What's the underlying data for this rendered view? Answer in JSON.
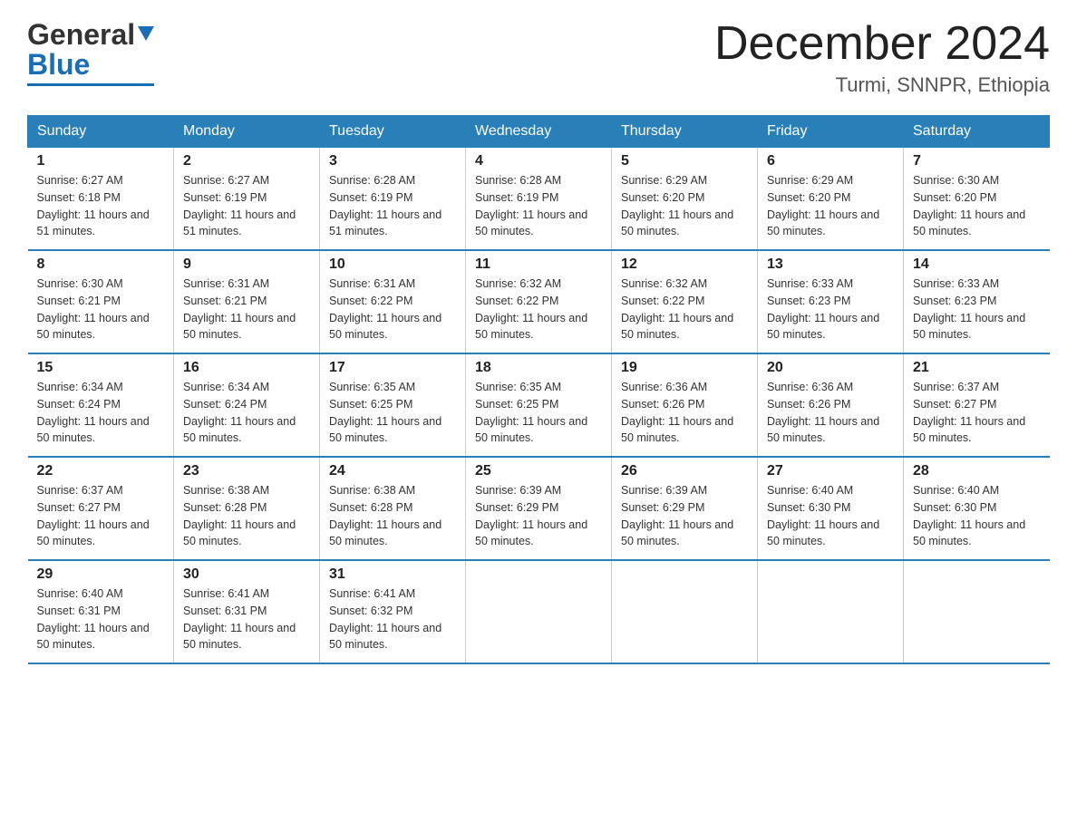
{
  "logo": {
    "general": "General",
    "blue": "Blue",
    "tagline": "GeneralBlue"
  },
  "header": {
    "month_year": "December 2024",
    "location": "Turmi, SNNPR, Ethiopia"
  },
  "days_of_week": [
    "Sunday",
    "Monday",
    "Tuesday",
    "Wednesday",
    "Thursday",
    "Friday",
    "Saturday"
  ],
  "weeks": [
    [
      {
        "day": 1,
        "sunrise": "6:27 AM",
        "sunset": "6:18 PM",
        "daylight": "11 hours and 51 minutes."
      },
      {
        "day": 2,
        "sunrise": "6:27 AM",
        "sunset": "6:19 PM",
        "daylight": "11 hours and 51 minutes."
      },
      {
        "day": 3,
        "sunrise": "6:28 AM",
        "sunset": "6:19 PM",
        "daylight": "11 hours and 51 minutes."
      },
      {
        "day": 4,
        "sunrise": "6:28 AM",
        "sunset": "6:19 PM",
        "daylight": "11 hours and 50 minutes."
      },
      {
        "day": 5,
        "sunrise": "6:29 AM",
        "sunset": "6:20 PM",
        "daylight": "11 hours and 50 minutes."
      },
      {
        "day": 6,
        "sunrise": "6:29 AM",
        "sunset": "6:20 PM",
        "daylight": "11 hours and 50 minutes."
      },
      {
        "day": 7,
        "sunrise": "6:30 AM",
        "sunset": "6:20 PM",
        "daylight": "11 hours and 50 minutes."
      }
    ],
    [
      {
        "day": 8,
        "sunrise": "6:30 AM",
        "sunset": "6:21 PM",
        "daylight": "11 hours and 50 minutes."
      },
      {
        "day": 9,
        "sunrise": "6:31 AM",
        "sunset": "6:21 PM",
        "daylight": "11 hours and 50 minutes."
      },
      {
        "day": 10,
        "sunrise": "6:31 AM",
        "sunset": "6:22 PM",
        "daylight": "11 hours and 50 minutes."
      },
      {
        "day": 11,
        "sunrise": "6:32 AM",
        "sunset": "6:22 PM",
        "daylight": "11 hours and 50 minutes."
      },
      {
        "day": 12,
        "sunrise": "6:32 AM",
        "sunset": "6:22 PM",
        "daylight": "11 hours and 50 minutes."
      },
      {
        "day": 13,
        "sunrise": "6:33 AM",
        "sunset": "6:23 PM",
        "daylight": "11 hours and 50 minutes."
      },
      {
        "day": 14,
        "sunrise": "6:33 AM",
        "sunset": "6:23 PM",
        "daylight": "11 hours and 50 minutes."
      }
    ],
    [
      {
        "day": 15,
        "sunrise": "6:34 AM",
        "sunset": "6:24 PM",
        "daylight": "11 hours and 50 minutes."
      },
      {
        "day": 16,
        "sunrise": "6:34 AM",
        "sunset": "6:24 PM",
        "daylight": "11 hours and 50 minutes."
      },
      {
        "day": 17,
        "sunrise": "6:35 AM",
        "sunset": "6:25 PM",
        "daylight": "11 hours and 50 minutes."
      },
      {
        "day": 18,
        "sunrise": "6:35 AM",
        "sunset": "6:25 PM",
        "daylight": "11 hours and 50 minutes."
      },
      {
        "day": 19,
        "sunrise": "6:36 AM",
        "sunset": "6:26 PM",
        "daylight": "11 hours and 50 minutes."
      },
      {
        "day": 20,
        "sunrise": "6:36 AM",
        "sunset": "6:26 PM",
        "daylight": "11 hours and 50 minutes."
      },
      {
        "day": 21,
        "sunrise": "6:37 AM",
        "sunset": "6:27 PM",
        "daylight": "11 hours and 50 minutes."
      }
    ],
    [
      {
        "day": 22,
        "sunrise": "6:37 AM",
        "sunset": "6:27 PM",
        "daylight": "11 hours and 50 minutes."
      },
      {
        "day": 23,
        "sunrise": "6:38 AM",
        "sunset": "6:28 PM",
        "daylight": "11 hours and 50 minutes."
      },
      {
        "day": 24,
        "sunrise": "6:38 AM",
        "sunset": "6:28 PM",
        "daylight": "11 hours and 50 minutes."
      },
      {
        "day": 25,
        "sunrise": "6:39 AM",
        "sunset": "6:29 PM",
        "daylight": "11 hours and 50 minutes."
      },
      {
        "day": 26,
        "sunrise": "6:39 AM",
        "sunset": "6:29 PM",
        "daylight": "11 hours and 50 minutes."
      },
      {
        "day": 27,
        "sunrise": "6:40 AM",
        "sunset": "6:30 PM",
        "daylight": "11 hours and 50 minutes."
      },
      {
        "day": 28,
        "sunrise": "6:40 AM",
        "sunset": "6:30 PM",
        "daylight": "11 hours and 50 minutes."
      }
    ],
    [
      {
        "day": 29,
        "sunrise": "6:40 AM",
        "sunset": "6:31 PM",
        "daylight": "11 hours and 50 minutes."
      },
      {
        "day": 30,
        "sunrise": "6:41 AM",
        "sunset": "6:31 PM",
        "daylight": "11 hours and 50 minutes."
      },
      {
        "day": 31,
        "sunrise": "6:41 AM",
        "sunset": "6:32 PM",
        "daylight": "11 hours and 50 minutes."
      },
      null,
      null,
      null,
      null
    ]
  ]
}
